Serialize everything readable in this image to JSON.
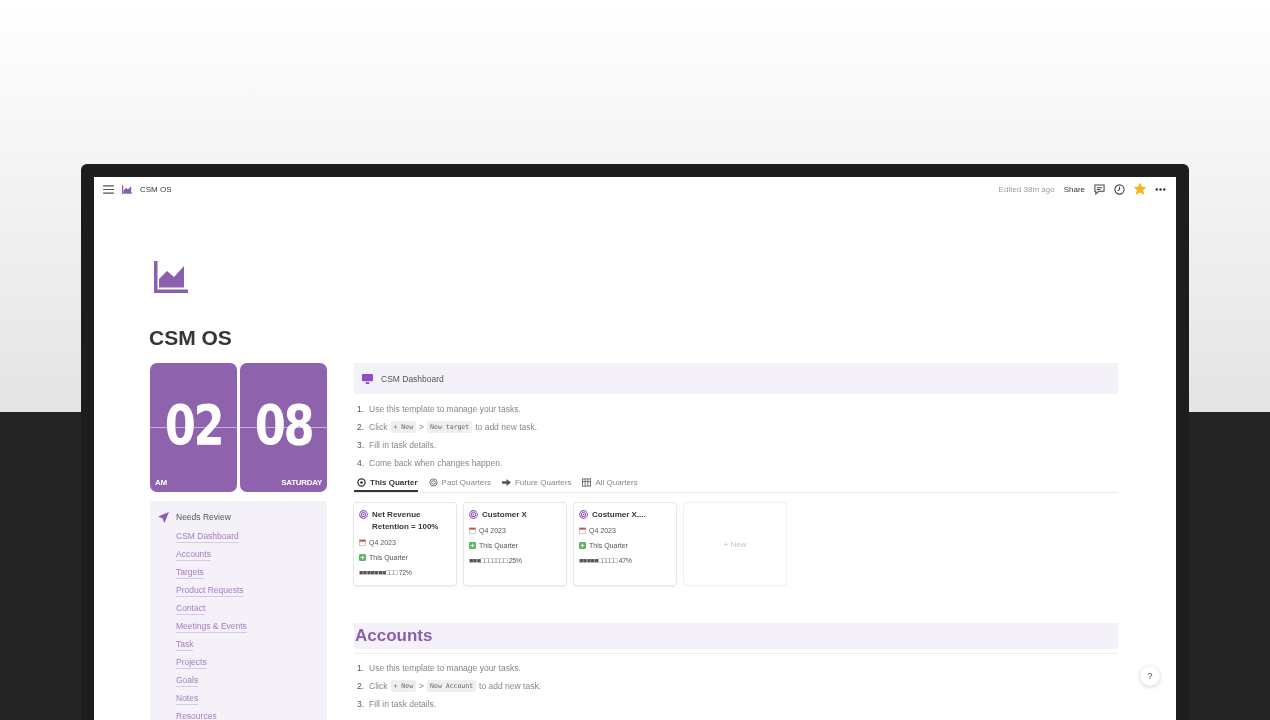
{
  "topbar": {
    "title": "CSM OS",
    "edited": "Edited 38m ago",
    "share": "Share",
    "favorite": true
  },
  "page": {
    "title": "CSM OS"
  },
  "clock": [
    {
      "digits": "02",
      "caption": "AM"
    },
    {
      "digits": "08",
      "caption": "SATURDAY"
    }
  ],
  "sidebar": {
    "heading": "Needs Review",
    "links": [
      "CSM Dashboard",
      "Accounts",
      "Targets",
      "Product Requests",
      "Contact",
      "Meetings & Events",
      "Task",
      "Projects",
      "Goals",
      "Notes",
      "Resources"
    ]
  },
  "dashboard": {
    "callout": "CSM Dashboard",
    "steps": [
      {
        "number": "1.",
        "segments": [
          {
            "kind": "text",
            "text": "Use this template to manage your tasks."
          }
        ]
      },
      {
        "number": "2.",
        "segments": [
          {
            "kind": "text",
            "text": "Click"
          },
          {
            "kind": "code",
            "text": "+ New"
          },
          {
            "kind": "text",
            "text": ">"
          },
          {
            "kind": "code",
            "text": "New target"
          },
          {
            "kind": "text",
            "text": "to add new task."
          }
        ]
      },
      {
        "number": "3.",
        "segments": [
          {
            "kind": "text",
            "text": "Fill in task details."
          }
        ]
      },
      {
        "number": "4.",
        "segments": [
          {
            "kind": "text",
            "text": "Come back when changes happen."
          }
        ]
      }
    ],
    "tabs": [
      {
        "label": "This Quarter",
        "selected": true
      },
      {
        "label": "Past Quarters",
        "selected": false
      },
      {
        "label": "Future Quarters",
        "selected": false
      },
      {
        "label": "All Quarters",
        "selected": false
      }
    ],
    "cards": [
      {
        "title": "Net Revenue Retention = 100%",
        "date": "Q4 2023",
        "status": "This Quarter",
        "progress": "■■■■■■■□□□ 72%"
      },
      {
        "title": "Customer X",
        "date": "Q4 2023",
        "status": "This Quarter",
        "progress": "■■■□□□□□□□ 25%"
      },
      {
        "title": "Costumer X....",
        "date": "Q4 2023",
        "status": "This Quarter",
        "progress": "■■■■■□□□□□ 47%"
      }
    ],
    "new_card": "+ New"
  },
  "accounts": {
    "heading": "Accounts",
    "steps": [
      {
        "number": "1.",
        "segments": [
          {
            "kind": "text",
            "text": "Use this template to manage your tasks."
          }
        ]
      },
      {
        "number": "2.",
        "segments": [
          {
            "kind": "text",
            "text": "Click"
          },
          {
            "kind": "code",
            "text": "+ New"
          },
          {
            "kind": "text",
            "text": ">"
          },
          {
            "kind": "code",
            "text": "New Account"
          },
          {
            "kind": "text",
            "text": "to add new task."
          }
        ]
      },
      {
        "number": "3.",
        "segments": [
          {
            "kind": "text",
            "text": "Fill in task details."
          }
        ]
      }
    ]
  },
  "help": "?"
}
